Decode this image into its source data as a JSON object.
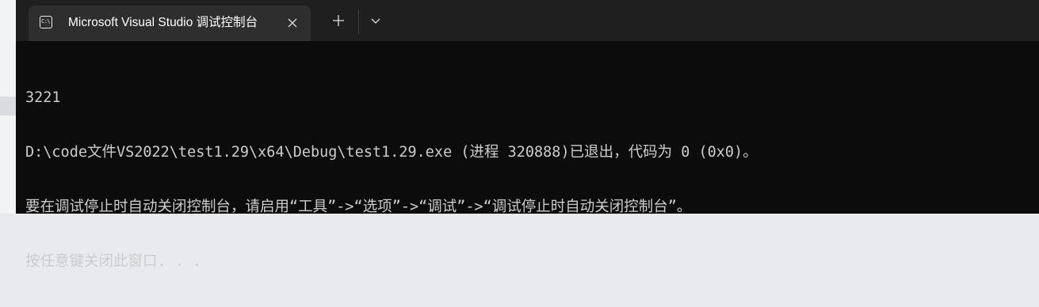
{
  "tab": {
    "icon": "terminal-icon",
    "icon_glyph": "C:\\",
    "title": "Microsoft Visual Studio 调试控制台"
  },
  "tabbar": {
    "new_tab_icon": "plus-icon",
    "dropdown_icon": "chevron-down-icon",
    "close_icon": "close-icon"
  },
  "console": {
    "lines": [
      "3221",
      "D:\\code文件VS2022\\test1.29\\x64\\Debug\\test1.29.exe (进程 320888)已退出，代码为 0 (0x0)。",
      "要在调试停止时自动关闭控制台，请启用“工具”->“选项”->“调试”->“调试停止时自动关闭控制台”。",
      "按任意键关闭此窗口. . ."
    ]
  },
  "colors": {
    "window_bg": "#0c0c0c",
    "tabbar_bg": "#1f1f1f",
    "active_tab_bg": "#2e2e2e",
    "text": "#cccccc"
  }
}
